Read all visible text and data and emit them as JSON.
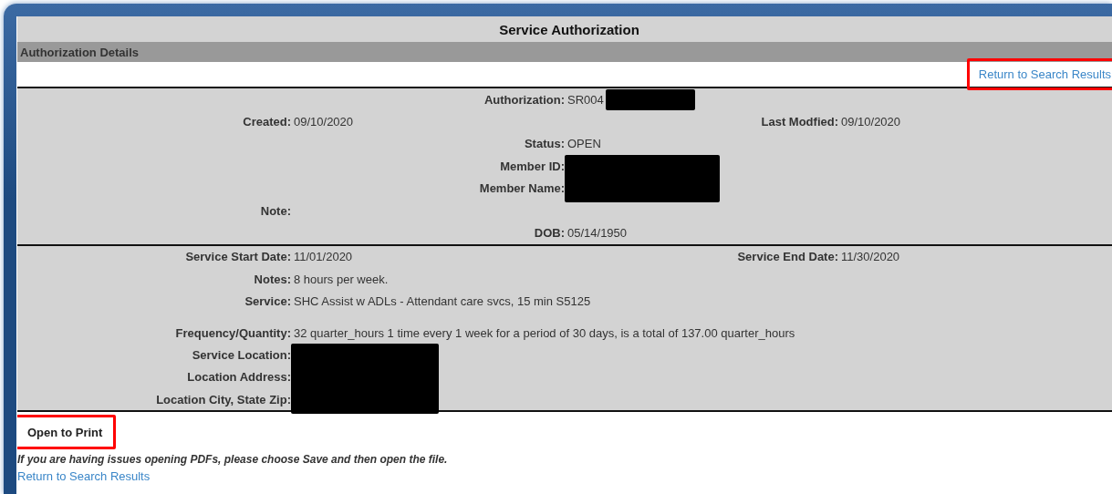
{
  "title": "Service Authorization",
  "section_header": "Authorization Details",
  "top_link": {
    "label": "Return to Search Results",
    "highlighted": true
  },
  "groups": [
    {
      "rows": [
        {
          "center": {
            "label": "Authorization:",
            "value": "SR004",
            "redacted": true
          }
        },
        {
          "left": {
            "label": "Created:",
            "value": "09/10/2020"
          },
          "right": {
            "label": "Last Modfied:",
            "value": "09/10/2020"
          }
        },
        {
          "center": {
            "label": "Status:",
            "value": "OPEN"
          }
        },
        {
          "center": {
            "label": "Member ID:",
            "redacted": true
          }
        },
        {
          "center": {
            "label": "Member Name:"
          }
        },
        {
          "left": {
            "label": "Note:"
          }
        },
        {
          "center": {
            "label": "DOB:",
            "value": "05/14/1950"
          }
        }
      ]
    },
    {
      "rows": [
        {
          "left": {
            "label": "Service Start Date:",
            "value": "11/01/2020"
          },
          "right": {
            "label": "Service End Date:",
            "value": "11/30/2020"
          }
        },
        {
          "left": {
            "label": "Notes:",
            "value": "8 hours per week."
          }
        },
        {
          "left": {
            "label": "Service:",
            "value": "SHC Assist w ADLs - Attendant care svcs, 15 min S5125"
          }
        },
        {
          "left": {
            "label": "Frequency/Quantity:",
            "value": "32 quarter_hours 1 time every 1 week for a period of 30 days, is a total of 137.00 quarter_hours"
          }
        },
        {
          "left": {
            "label": "Service Location:",
            "redacted": true
          }
        },
        {
          "left": {
            "label": "Location Address:"
          }
        },
        {
          "left": {
            "label": "Location City, State Zip:"
          }
        }
      ]
    }
  ],
  "print_button": {
    "label": "Open to Print",
    "highlighted": true
  },
  "pdf_note": "If you are having issues opening PDFs, please choose Save and then open the file.",
  "bottom_link": {
    "label": "Return to Search Results",
    "highlighted": false
  }
}
